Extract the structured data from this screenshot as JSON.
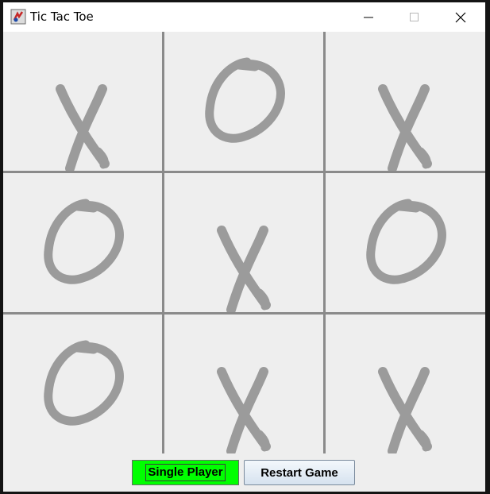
{
  "window": {
    "title": "Tic Tac Toe",
    "controls": [
      "minimize-icon",
      "maximize-icon",
      "close-icon"
    ]
  },
  "board": {
    "mark_color": "#9b9b9b",
    "cells": [
      "X",
      "O",
      "X",
      "O",
      "X",
      "O",
      "O",
      "X",
      "X"
    ]
  },
  "buttons": {
    "single_player": "Single Player",
    "restart_game": "Restart Game",
    "single_player_color": "#00ff00"
  }
}
